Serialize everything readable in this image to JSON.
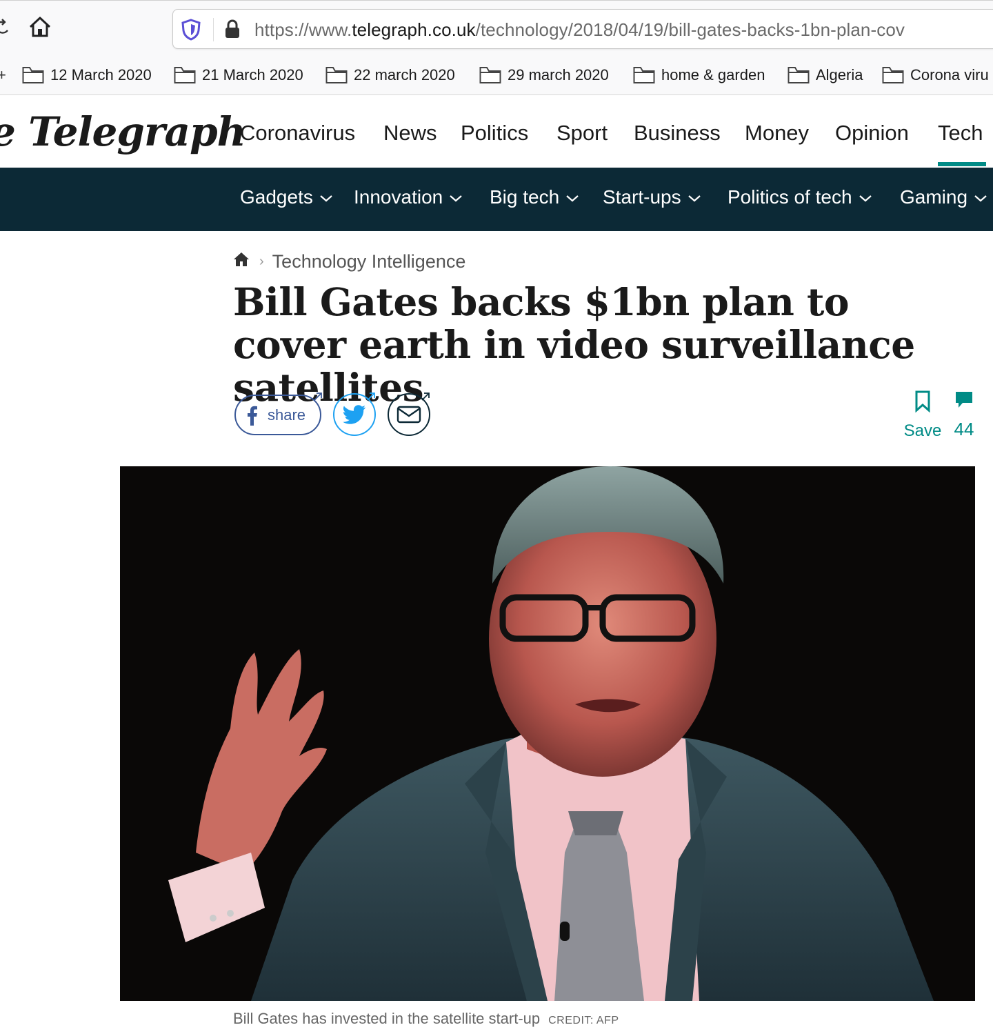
{
  "browser": {
    "url_prefix": "https://www.",
    "url_domain": "telegraph.co.uk",
    "url_path": "/technology/2018/04/19/bill-gates-backs-1bn-plan-cov",
    "bookmarks": [
      "12 March 2020",
      "21 March 2020",
      "22 march 2020",
      "29 march 2020",
      "home & garden",
      "Algeria",
      "Corona viru"
    ]
  },
  "site": {
    "logo": "e Telegraph",
    "main_nav": [
      "Coronavirus",
      "News",
      "Politics",
      "Sport",
      "Business",
      "Money",
      "Opinion",
      "Tech"
    ],
    "active_nav": "Tech",
    "sub_nav": [
      "Gadgets",
      "Innovation",
      "Big tech",
      "Start-ups",
      "Politics of tech",
      "Gaming"
    ],
    "accent_color": "#008b86",
    "subnav_bg": "#0c2936"
  },
  "article": {
    "breadcrumb": "Technology Intelligence",
    "headline": "Bill Gates backs $1bn plan to cover earth in video surveillance satellites",
    "share_label": "share",
    "save_label": "Save",
    "comment_count": "44",
    "caption": "Bill Gates has invested in the satellite start-up",
    "credit": "CREDIT: AFP"
  }
}
